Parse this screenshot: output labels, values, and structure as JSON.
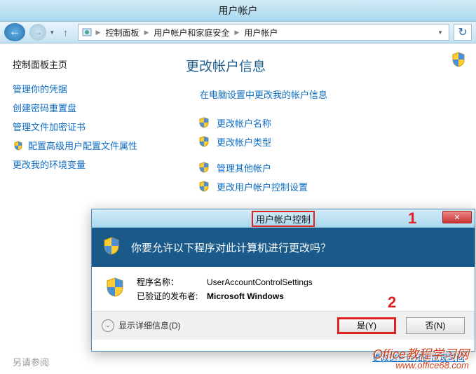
{
  "titlebar": {
    "title": "用户帐户"
  },
  "breadcrumb": {
    "items": [
      "控制面板",
      "用户帐户和家庭安全",
      "用户帐户"
    ]
  },
  "sidebar": {
    "title": "控制面板主页",
    "links": [
      "管理你的凭据",
      "创建密码重置盘",
      "管理文件加密证书",
      "配置高级用户配置文件属性",
      "更改我的环境变量"
    ],
    "bottom": "另请参阅"
  },
  "main": {
    "heading": "更改帐户信息",
    "primary_link": "在电脑设置中更改我的帐户信息",
    "group1": [
      "更改帐户名称",
      "更改帐户类型"
    ],
    "group2": [
      "管理其他帐户",
      "更改用户帐户控制设置"
    ]
  },
  "dialog": {
    "title": "用户帐户控制",
    "question": "你要允许以下程序对此计算机进行更改吗？",
    "program_label": "程序名称：",
    "program_name": "UserAccountControlSettings",
    "publisher_label": "已验证的发布者:",
    "publisher_name": "Microsoft Windows",
    "details": "显示详细信息(D)",
    "yes": "是(Y)",
    "no": "否(N)",
    "notif_link": "更改这些通知的出现时间"
  },
  "annotations": {
    "one": "1",
    "two": "2"
  },
  "watermark": {
    "line1": "Office教程学习网",
    "line2": "www.office68.com"
  }
}
